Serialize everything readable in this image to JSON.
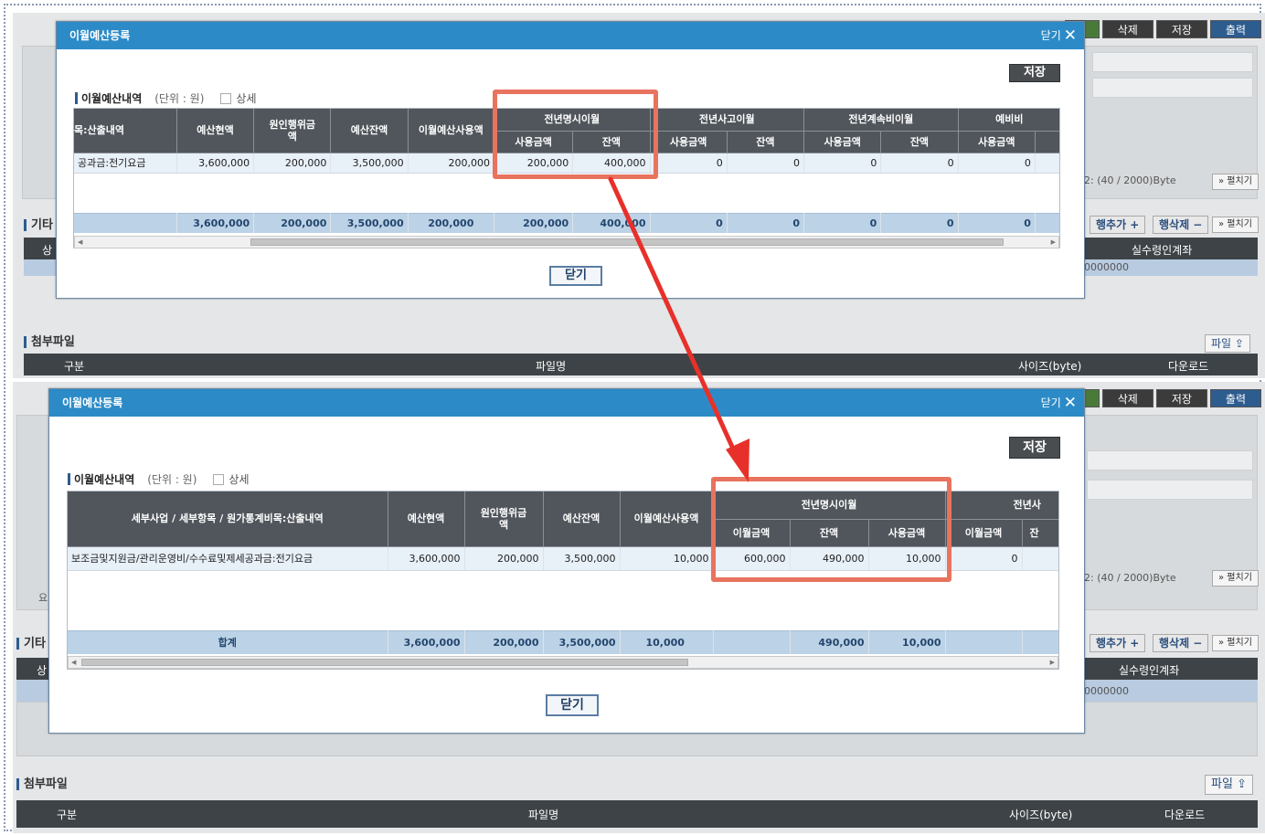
{
  "background": {
    "toolbar": [
      "삭제",
      "저장",
      "출력"
    ],
    "byte_counter": "2: (40 / 2000)Byte",
    "expand_label": "펼치기",
    "other_section": "기타",
    "row_add": "행추가 +",
    "row_delete": "행삭제 −",
    "account_header": "실수령인계좌",
    "account_value": "0000000",
    "header_cut": "상",
    "req_label": "요",
    "attach": {
      "title": "첨부파일",
      "file_button": "파일",
      "columns": [
        "구분",
        "파일명",
        "사이즈(byte)",
        "다운로드"
      ]
    }
  },
  "dialog1": {
    "title": "이월예산등록",
    "close_label": "닫기",
    "save_label": "저장",
    "section_title": "이월예산내역",
    "unit": "(단위 : 원)",
    "detail_label": "상세",
    "headers": {
      "col1": "목:산출내역",
      "col2": "예산현액",
      "col3": "원인행위금액",
      "col4": "예산잔액",
      "col5": "이월예산사용액",
      "group1": "전년명시이월",
      "group2": "전년사고이월",
      "group3": "전년계속비이월",
      "group4": "예비비",
      "sub_use": "사용금액",
      "sub_bal": "잔액"
    },
    "row": [
      "공과금:전기요금",
      "3,600,000",
      "200,000",
      "3,500,000",
      "200,000",
      "200,000",
      "400,000",
      "0",
      "0",
      "0",
      "0",
      "0"
    ],
    "total": [
      "",
      "3,600,000",
      "200,000",
      "3,500,000",
      "200,000",
      "200,000",
      "400,000",
      "0",
      "0",
      "0",
      "0",
      "0"
    ],
    "close_button": "닫기"
  },
  "dialog2": {
    "title": "이월예산등록",
    "close_label": "닫기",
    "save_label": "저장",
    "section_title": "이월예산내역",
    "unit": "(단위 : 원)",
    "detail_label": "상세",
    "headers": {
      "col1": "세부사업 / 세부항목 / 원가통계비목:산출내역",
      "col2": "예산현액",
      "col3": "원인행위금액",
      "col4": "예산잔액",
      "col5": "이월예산사용액",
      "group1": "전년명시이월",
      "group2": "전년사",
      "sub_carry": "이월금액",
      "sub_bal": "잔액",
      "sub_use": "사용금액",
      "sub_bal_cut": "잔"
    },
    "row": [
      "보조금및지원금/관리운영비/수수료및제세공과금:전기요금",
      "3,600,000",
      "200,000",
      "3,500,000",
      "10,000",
      "600,000",
      "490,000",
      "10,000",
      "0",
      ""
    ],
    "total": [
      "합계",
      "3,600,000",
      "200,000",
      "3,500,000",
      "10,000",
      "",
      "490,000",
      "10,000",
      "",
      ""
    ],
    "close_button": "닫기"
  },
  "colors": {
    "title_bar": "#2c8bc7",
    "highlight": "#e8735e",
    "arrow": "#e8302a",
    "header_bg": "#50565c",
    "total_row": "#bcd2e6"
  }
}
